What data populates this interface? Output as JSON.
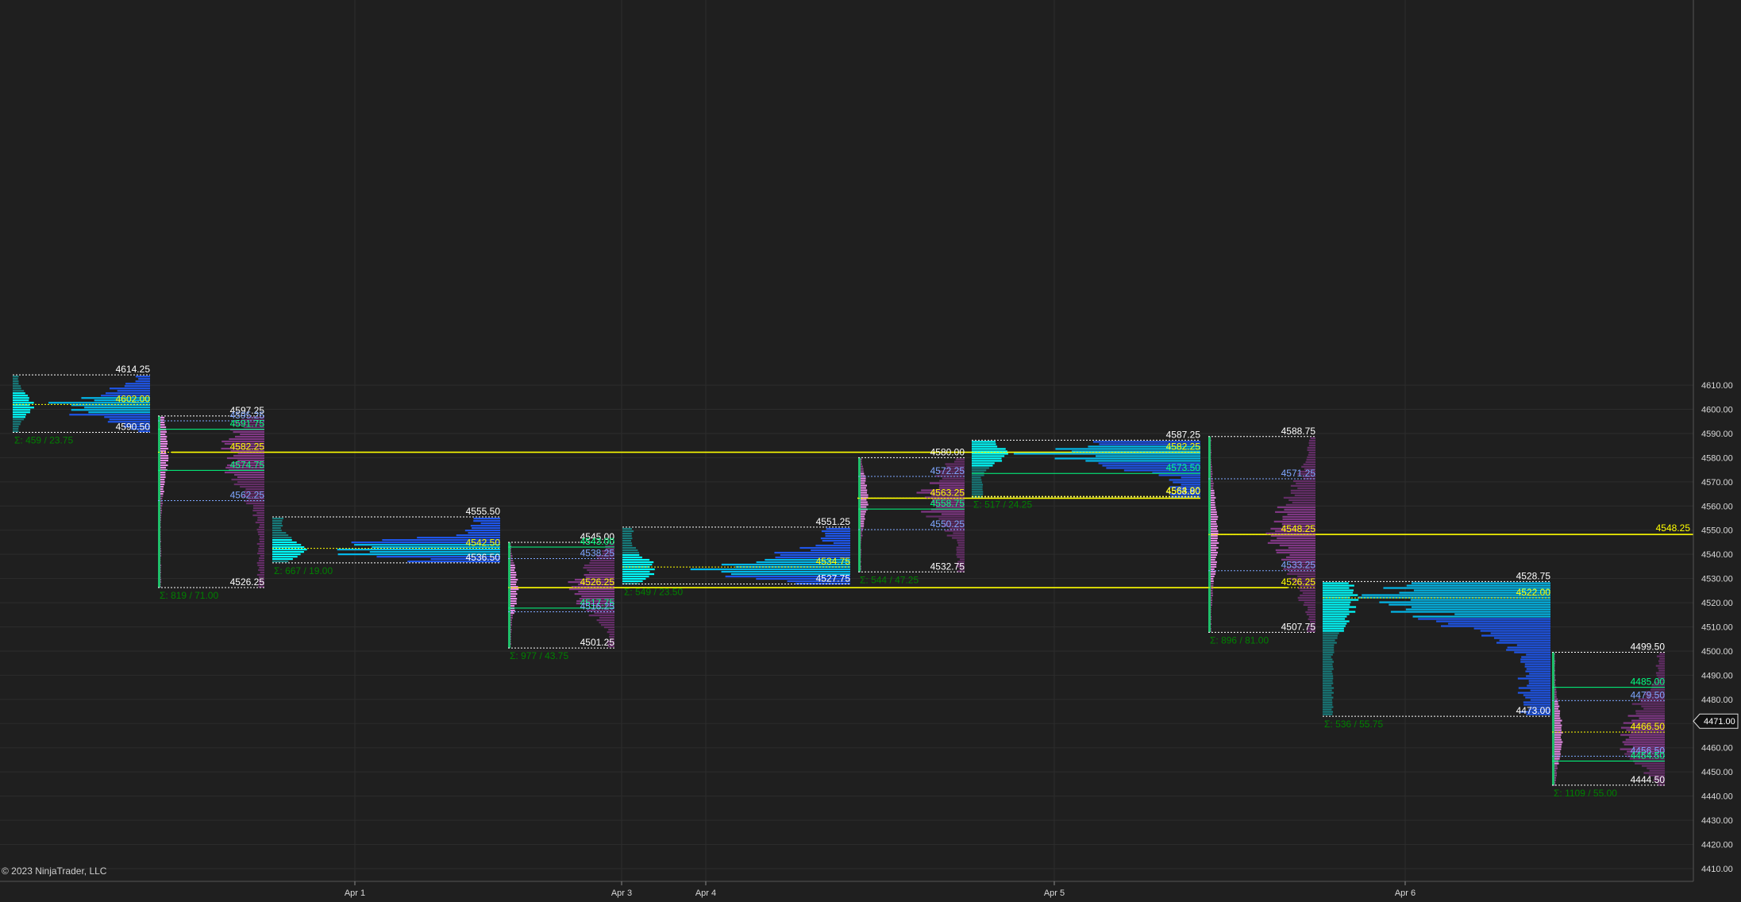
{
  "app": {
    "copyright": "© 2023 NinjaTrader, LLC"
  },
  "colors": {
    "background": "#1f1f1f",
    "grid": "#2c2c2c",
    "axis_text": "#d8d8d8",
    "high_low": "#ffffff",
    "poc": "#ffff00",
    "vah_val": "#7fa7ff",
    "hvn": "#00ff80",
    "footer": "#008000",
    "cyan": "#00ffff",
    "blue": "#1e5bff",
    "pink": "#e58ae5",
    "purple": "#6a2f6e",
    "green_bar": "#1fbf6a"
  },
  "chart_data": {
    "type": "volume-profile",
    "y_axis": {
      "min": 4405,
      "max": 4617,
      "ticks": [
        "4410.00",
        "4420.00",
        "4430.00",
        "4440.00",
        "4450.00",
        "4460.00",
        "4470.00",
        "4480.00",
        "4490.00",
        "4500.00",
        "4510.00",
        "4520.00",
        "4530.00",
        "4540.00",
        "4550.00",
        "4560.00",
        "4570.00",
        "4580.00",
        "4590.00",
        "4600.00",
        "4610.00"
      ],
      "current_price": "4471.00"
    },
    "x_axis": {
      "labels": [
        "Apr 1",
        "Apr 3",
        "Apr 4",
        "Apr 5",
        "Apr 6"
      ]
    },
    "grid": true,
    "profiles": [
      {
        "high": "4614.25",
        "low": "4590.50",
        "levels": [
          {
            "price": "4602.00",
            "type": "poc"
          }
        ],
        "footer": "Σ: 459 / 23.75",
        "left": "cyan",
        "right": "blue",
        "right_extent": "4602.00"
      },
      {
        "high": "4597.25",
        "low": "4526.25",
        "levels": [
          {
            "price": "4595.25",
            "type": "value"
          },
          {
            "price": "4591.75",
            "type": "hvn"
          },
          {
            "price": "4582.25",
            "type": "poc"
          },
          {
            "price": "4574.75",
            "type": "hvn"
          },
          {
            "price": "4562.25",
            "type": "value"
          }
        ],
        "footer": "Σ: 819 / 71.00",
        "left": "pink",
        "right": "purple"
      },
      {
        "high": "4555.50",
        "low": "4536.50",
        "levels": [
          {
            "price": "4542.50",
            "type": "poc"
          }
        ],
        "footer": "Σ: 667 / 19.00",
        "left": "cyan",
        "right": "blue"
      },
      {
        "high": "4545.00",
        "low": "4501.25",
        "levels": [
          {
            "price": "4543.00",
            "type": "hvn"
          },
          {
            "price": "4538.25",
            "type": "value"
          },
          {
            "price": "4526.25",
            "type": "poc"
          },
          {
            "price": "4517.75",
            "type": "hvn"
          },
          {
            "price": "4516.25",
            "type": "value"
          }
        ],
        "footer": "Σ: 977 / 43.75",
        "left": "pink",
        "right": "purple"
      },
      {
        "high": "4551.25",
        "low": "4527.75",
        "levels": [
          {
            "price": "4534.75",
            "type": "poc"
          }
        ],
        "footer": "Σ: 549 / 23.50",
        "left": "cyan",
        "right": "blue"
      },
      {
        "high": "4580.00",
        "low": "4532.75",
        "levels": [
          {
            "price": "4572.25",
            "type": "value"
          },
          {
            "price": "4563.25",
            "type": "poc"
          },
          {
            "price": "4558.75",
            "type": "hvn"
          },
          {
            "price": "4550.25",
            "type": "value"
          }
        ],
        "footer": "Σ: 544 / 47.25",
        "left": "pink",
        "right": "purple"
      },
      {
        "high": "4587.25",
        "low": "4563.80",
        "levels": [
          {
            "price": "4582.25",
            "type": "poc"
          },
          {
            "price": "4573.50",
            "type": "hvn"
          },
          {
            "price": "4564.00",
            "type": "poc"
          }
        ],
        "footer": "Σ: 517 / 24.25",
        "left": "cyan",
        "right": "blue"
      },
      {
        "high": "4588.75",
        "low": "4507.75",
        "levels": [
          {
            "price": "4571.25",
            "type": "value"
          },
          {
            "price": "4548.25",
            "type": "poc"
          },
          {
            "price": "4533.25",
            "type": "value"
          },
          {
            "price": "4526.25",
            "type": "poc"
          }
        ],
        "footer": "Σ: 896 / 81.00",
        "left": "pink",
        "right": "purple"
      },
      {
        "high": "4528.75",
        "low": "4473.00",
        "levels": [
          {
            "price": "4522.00",
            "type": "poc"
          }
        ],
        "footer": "Σ: 536 / 55.75",
        "left": "cyan",
        "right": "blue"
      },
      {
        "high": "4499.50",
        "low": "4444.50",
        "levels": [
          {
            "price": "4485.00",
            "type": "hvn"
          },
          {
            "price": "4479.50",
            "type": "value"
          },
          {
            "price": "4466.50",
            "type": "poc"
          },
          {
            "price": "4456.50",
            "type": "value"
          },
          {
            "price": "4454.50",
            "type": "hvn"
          }
        ],
        "footer": "Σ: 1109 / 55.00",
        "left": "pink",
        "right": "purple"
      }
    ],
    "naked_pocs": [
      {
        "price": "4582.25"
      },
      {
        "price": "4548.25",
        "label": "4548.25"
      },
      {
        "price": "4526.25"
      },
      {
        "price": "4563.25"
      }
    ]
  }
}
